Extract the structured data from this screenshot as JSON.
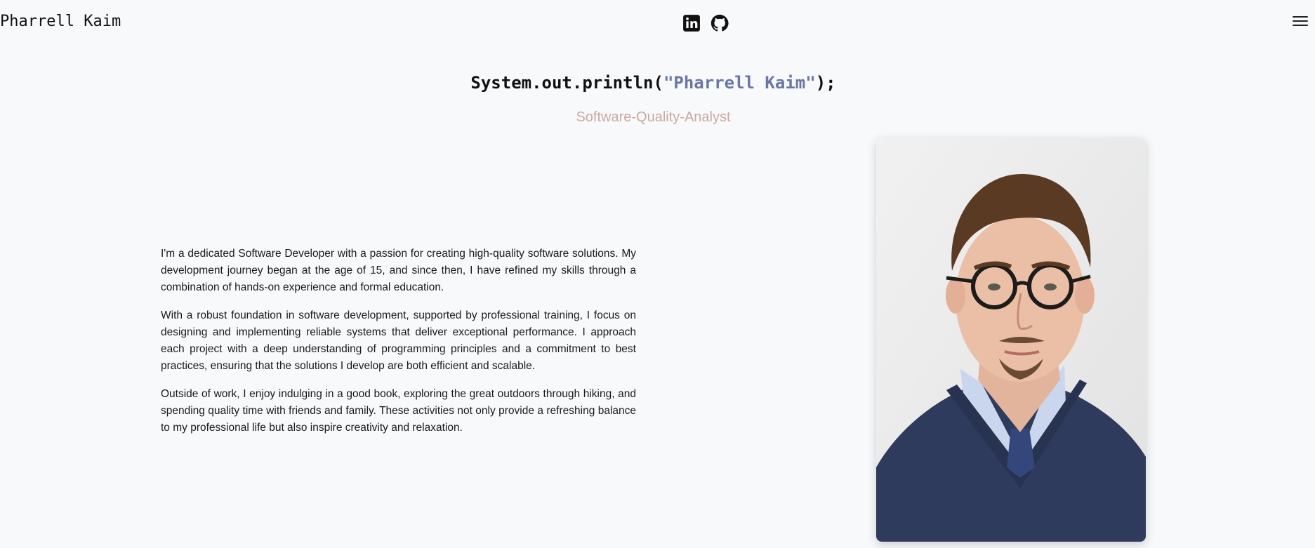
{
  "header": {
    "brand": "Pharrell Kaim",
    "social": [
      {
        "name": "linkedin-icon"
      },
      {
        "name": "github-icon"
      }
    ],
    "menu_icon": "hamburger-menu-icon"
  },
  "hero": {
    "code_prefix": "System.out.println(",
    "code_string": "\"Pharrell Kaim\"",
    "code_suffix": ");",
    "role": "Software-Quality-Analyst"
  },
  "about": {
    "paragraphs": [
      "I'm a dedicated Software Developer with a passion for creating high-quality software solutions. My development journey began at the age of 15, and since then, I have refined my skills through a combination of hands-on experience and formal education.",
      "With a robust foundation in software development, supported by professional training, I focus on designing and implementing reliable systems that deliver exceptional performance. I approach each project with a deep understanding of programming principles and a commitment to best practices, ensuring that the solutions I develop are both efficient and scalable.",
      "Outside of work, I enjoy indulging in a good book, exploring the great outdoors through hiking, and spending quality time with friends and family. These activities not only provide a refreshing balance to my professional life but also inspire creativity and relaxation."
    ]
  },
  "colors": {
    "background": "#f8f9fb",
    "code_string": "#6b76a6",
    "role": "#c9a99f"
  }
}
